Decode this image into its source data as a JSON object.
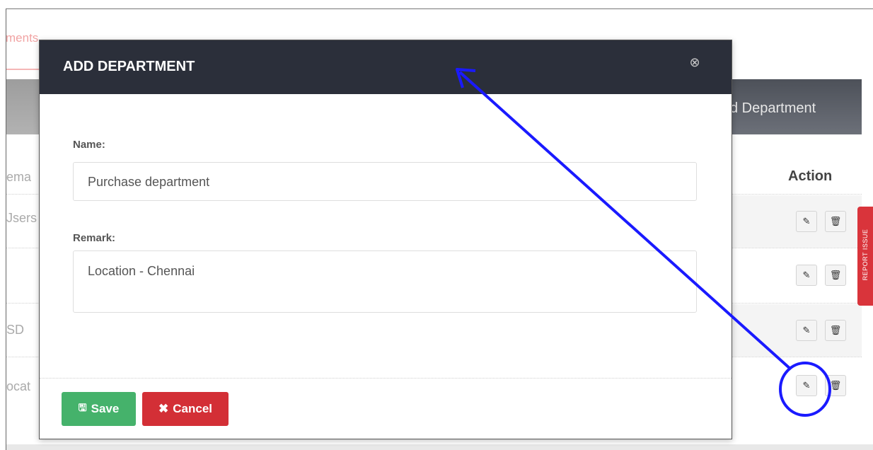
{
  "background": {
    "tab_fragment": "ments",
    "toolbar_button_label": "d Department",
    "column_header_fragment": "ema",
    "action_header": "Action",
    "row_fragments": [
      "Jsers",
      "",
      "SD",
      "ocat"
    ],
    "row_action_icons": {
      "edit": "pencil-icon",
      "delete": "trash-icon"
    },
    "report_tab_label": "REPORT ISSUE"
  },
  "modal": {
    "title": "ADD DEPARTMENT",
    "close_icon": "close-circle-icon",
    "name_label": "Name:",
    "name_value": "Purchase department",
    "remark_label": "Remark:",
    "remark_value": "Location - Chennai",
    "save_label": "Save",
    "cancel_label": "Cancel"
  },
  "annotation": {
    "color": "#1a1aff",
    "shape": "arrow-from-circled-edit-button-to-dialog-title"
  },
  "colors": {
    "header_bg": "#2b2f3a",
    "save_green": "#45b26b",
    "cancel_red": "#d32f36",
    "report_red": "#d9343b"
  }
}
